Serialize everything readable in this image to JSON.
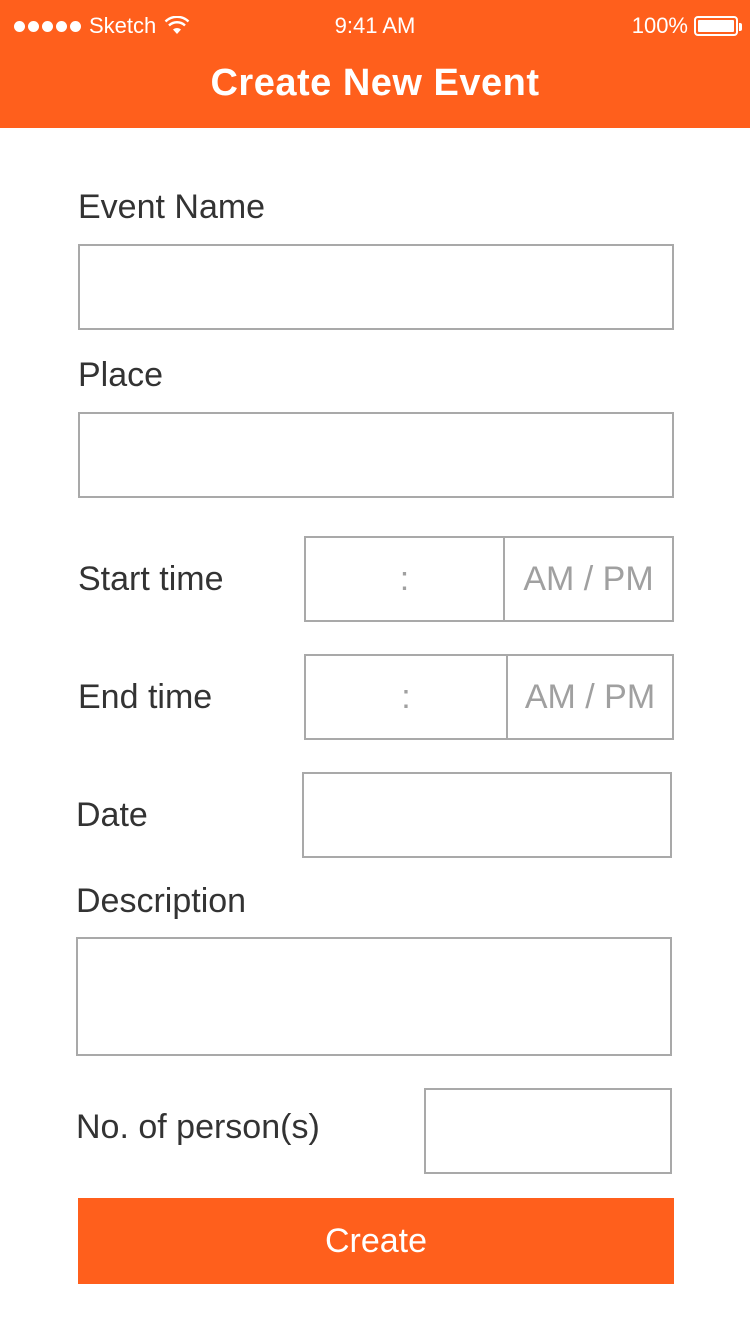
{
  "status_bar": {
    "carrier": "Sketch",
    "time": "9:41 AM",
    "battery": "100%"
  },
  "header": {
    "title": "Create New Event"
  },
  "form": {
    "event_name": {
      "label": "Event Name",
      "value": ""
    },
    "place": {
      "label": "Place",
      "value": ""
    },
    "start_time": {
      "label": "Start time",
      "separator": ":",
      "ampm": "AM / PM"
    },
    "end_time": {
      "label": "End time",
      "separator": ":",
      "ampm": "AM / PM"
    },
    "date": {
      "label": "Date",
      "value": ""
    },
    "description": {
      "label": "Description",
      "value": ""
    },
    "persons": {
      "label": "No. of person(s)",
      "value": ""
    }
  },
  "actions": {
    "create_label": "Create"
  },
  "colors": {
    "accent": "#FF5F1C",
    "border": "#A9A9A9",
    "text": "#333333",
    "placeholder": "#A0A0A0"
  },
  "icons": [
    "signal-dots-icon",
    "wifi-icon",
    "battery-icon"
  ]
}
